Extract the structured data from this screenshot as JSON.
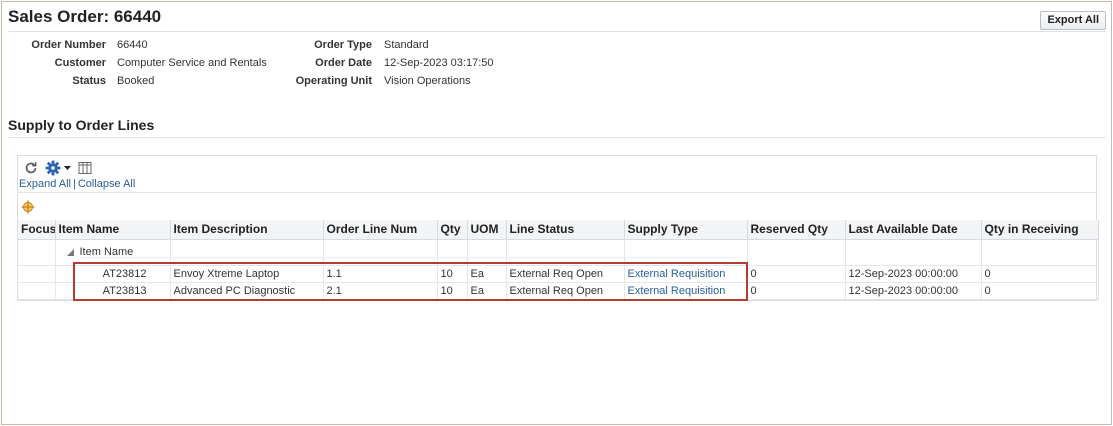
{
  "page": {
    "title": "Sales Order: 66440",
    "export_label": "Export All"
  },
  "order_info": {
    "order_number_label": "Order Number",
    "order_number": "66440",
    "customer_label": "Customer",
    "customer": "Computer Service and Rentals",
    "status_label": "Status",
    "status": "Booked",
    "order_type_label": "Order Type",
    "order_type": "Standard",
    "order_date_label": "Order Date",
    "order_date": "12-Sep-2023 03:17:50",
    "operating_unit_label": "Operating Unit",
    "operating_unit": "Vision Operations"
  },
  "section": {
    "title": "Supply to Order Lines"
  },
  "toolbar": {
    "refresh_icon": "refresh-icon",
    "settings_icon": "gear-icon",
    "columns_icon": "columns-icon",
    "expand_all": "Expand All",
    "separator": "|",
    "collapse_all": "Collapse All",
    "focus_icon": "focus-crosshair-icon"
  },
  "table": {
    "columns": [
      "Focus",
      "Item Name",
      "Item Description",
      "Order Line Num",
      "Qty",
      "UOM",
      "Line Status",
      "Supply Type",
      "Reserved Qty",
      "Last Available Date",
      "Qty in Receiving"
    ],
    "group_label": "Item Name",
    "rows": [
      {
        "item_name": "AT23812",
        "item_description": "Envoy Xtreme Laptop",
        "order_line_num": "1.1",
        "qty": "10",
        "uom": "Ea",
        "line_status": "External Req Open",
        "supply_type": "External Requisition",
        "reserved_qty": "0",
        "last_available_date": "12-Sep-2023 00:00:00",
        "qty_in_receiving": "0"
      },
      {
        "item_name": "AT23813",
        "item_description": "Advanced PC Diagnostic",
        "order_line_num": "2.1",
        "qty": "10",
        "uom": "Ea",
        "line_status": "External Req Open",
        "supply_type": "External Requisition",
        "reserved_qty": "0",
        "last_available_date": "12-Sep-2023 00:00:00",
        "qty_in_receiving": "0"
      }
    ]
  },
  "colors": {
    "link": "#2a5d9a",
    "highlight": "#b63b35",
    "header_bg": "#f2f4f6"
  }
}
